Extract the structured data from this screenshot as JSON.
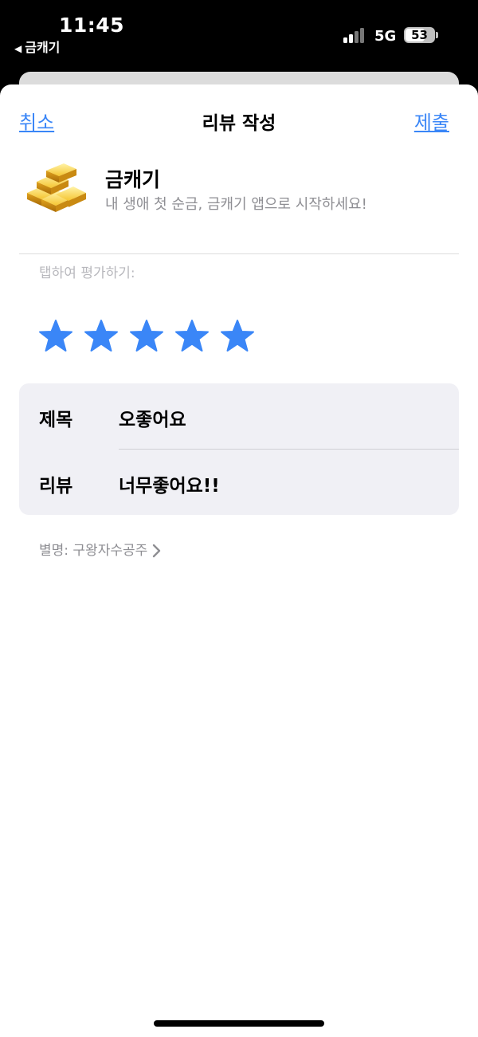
{
  "status_bar": {
    "time": "11:45",
    "back_app": "금캐기",
    "network": "5G",
    "battery": "53"
  },
  "nav": {
    "cancel_label": "취소",
    "title": "리뷰 작성",
    "submit_label": "제출"
  },
  "app": {
    "name": "금캐기",
    "subtitle": "내 생애 첫 순금, 금캐기 앱으로 시작하세요!",
    "icon": "gold-bars-icon"
  },
  "rating": {
    "prompt": "탭하여 평가하기:",
    "value": 5,
    "max": 5,
    "star_color": "#3a86f7"
  },
  "form": {
    "title_label": "제목",
    "title_value": "오좋어요",
    "review_label": "리뷰",
    "review_value": "너무좋어요!!"
  },
  "nickname": {
    "text": "별명: 구왕자수공주"
  },
  "colors": {
    "accent": "#3a86f7",
    "secondary_text": "#8e8e93",
    "card_bg": "#f0f0f5"
  }
}
